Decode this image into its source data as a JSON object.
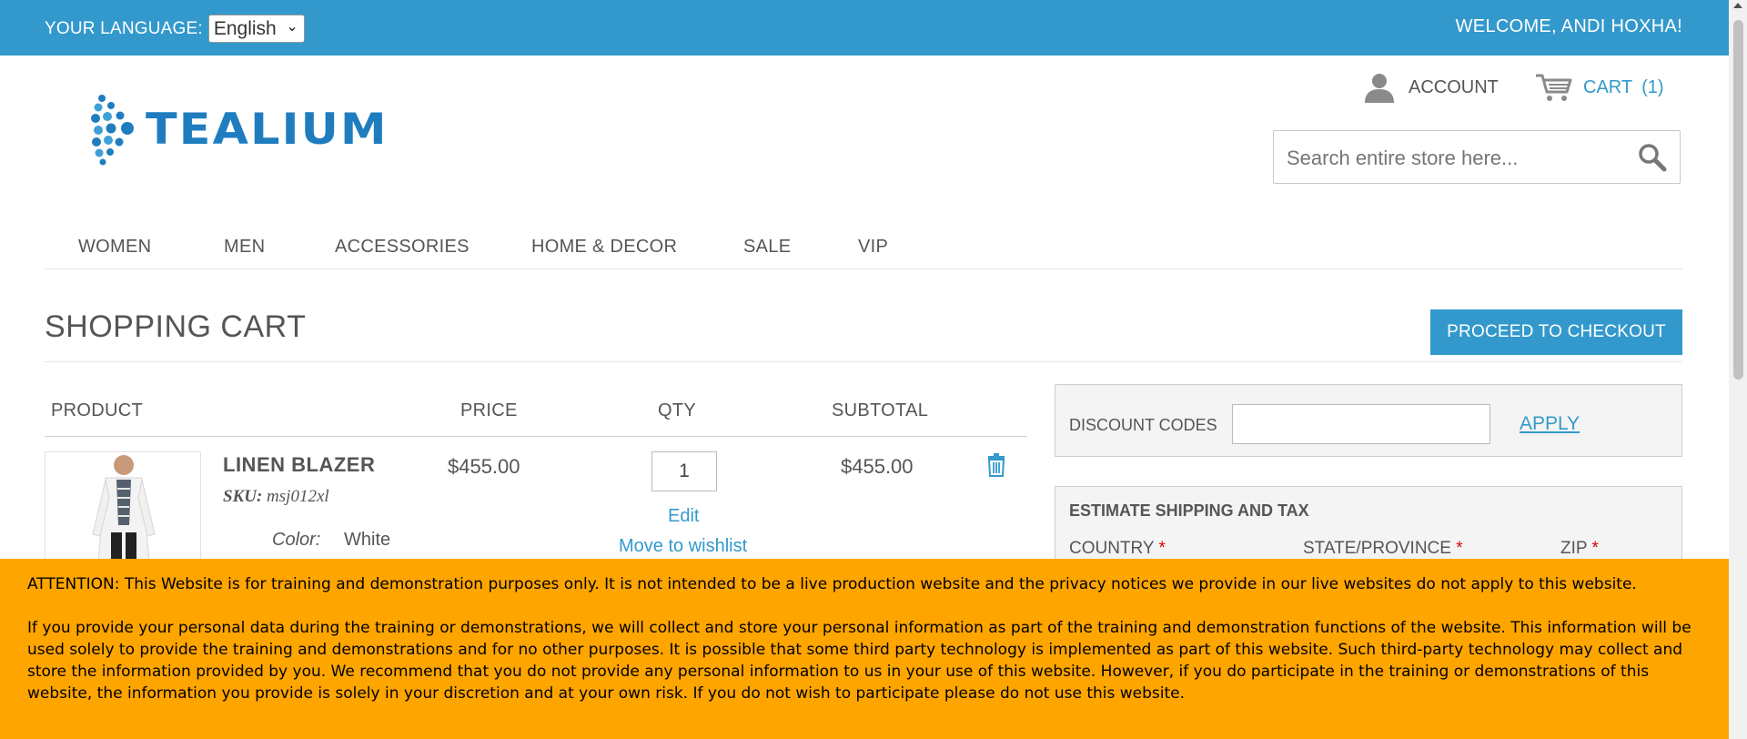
{
  "topbar": {
    "language_label": "YOUR LANGUAGE:",
    "language_value": "English",
    "welcome": "WELCOME, ANDI HOXHA!"
  },
  "header": {
    "logo_text": "TEALIUM",
    "account_label": "ACCOUNT",
    "cart_label": "CART",
    "cart_count": "(1)",
    "search_placeholder": "Search entire store here..."
  },
  "nav": {
    "items": [
      "WOMEN",
      "MEN",
      "ACCESSORIES",
      "HOME & DECOR",
      "SALE",
      "VIP"
    ]
  },
  "page": {
    "title": "SHOPPING CART",
    "checkout_label": "PROCEED TO CHECKOUT"
  },
  "cart_table": {
    "headers": [
      "PRODUCT",
      "PRICE",
      "QTY",
      "SUBTOTAL"
    ],
    "items": [
      {
        "name": "LINEN BLAZER",
        "sku_label": "SKU:",
        "sku": "msj012xl",
        "color_label": "Color:",
        "color_value": "White",
        "price": "$455.00",
        "qty": "1",
        "edit_label": "Edit",
        "wishlist_label": "Move to wishlist",
        "subtotal": "$455.00"
      }
    ]
  },
  "discount": {
    "label": "DISCOUNT CODES",
    "apply_label": "APPLY"
  },
  "shipping": {
    "title": "ESTIMATE SHIPPING AND TAX",
    "fields": [
      "COUNTRY",
      "STATE/PROVINCE",
      "ZIP"
    ],
    "required_mark": "*"
  },
  "notice": {
    "paragraph1": "ATTENTION: This Website is for training and demonstration purposes only. It is not intended to be a live production website and the privacy notices we provide in our live websites do not apply to this website.",
    "paragraph2": "If you provide your personal data during the training or demonstrations, we will collect and store your personal information as part of the training and demonstration functions of the website. This information will be used solely to provide the training and demonstrations and for no other purposes. It is possible that some third party technology is implemented as part of this website. Such third-party technology may collect and store the information provided by you. We recommend that you do not provide any personal information to us in your use of this website. However, if you do participate in the training or demonstrations of this website, the information you provide is solely in your discretion and at your own risk. If you do not wish to participate please do not use this website."
  },
  "colors": {
    "accent": "#3399cc",
    "notice_bg": "#ffa500",
    "logo": "#1f7dbf"
  }
}
